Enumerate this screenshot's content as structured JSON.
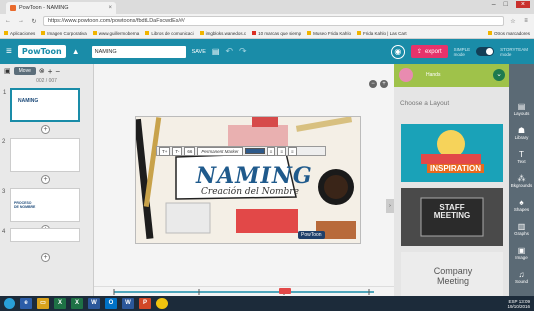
{
  "browser": {
    "tab_title": "PowToon - NAMING",
    "url": "https://www.powtoon.com/powtoons/fbdtLDaFscwdEs/#/",
    "bookmarks": [
      "Aplicaciones",
      "Imagen Corporativa",
      "www.guillermoberna",
      "Libros de comunicaci",
      "imgbloks.wanedos.c",
      "10 marcas que siemp",
      "Museo Frida Kahlo",
      "Frida Kahlo | Las Cart"
    ],
    "bookmarks_other": "Otros marcadores"
  },
  "app": {
    "logo": "PowToon",
    "title_input": "NAMING",
    "save_label": "SAVE",
    "export_label": "export",
    "mode_left": "SIMPLE\nmode",
    "mode_right": "STORYTEAM\nmode"
  },
  "slides": {
    "move_label": "Move",
    "counter": "002 / 007",
    "items": [
      {
        "num": "1",
        "title": "NAMING"
      },
      {
        "num": "2",
        "title": ""
      },
      {
        "num": "3",
        "title": "PROCESO DE NOMBRE"
      },
      {
        "num": "4",
        "title": ""
      }
    ]
  },
  "canvas": {
    "headline": "NAMING",
    "subtitle": "Creación del Nombre",
    "font_name": "Permanent Marker",
    "font_size": "66",
    "brand_tag": "PowToon"
  },
  "library": {
    "panel_title": "Hands",
    "choose_layout": "Choose a Layout",
    "layouts": [
      {
        "label": "INSPIRATION",
        "sub": "Bright"
      },
      {
        "label": "STAFF MEETING",
        "sub": ""
      },
      {
        "label": "Company Meeting",
        "sub": ""
      }
    ]
  },
  "sidebar": {
    "items": [
      "Layouts",
      "Library",
      "Text",
      "Bkgrounds",
      "Shapes",
      "Graphs",
      "Image",
      "Sound"
    ]
  },
  "taskbar": {
    "lang": "ESP",
    "time": "13:09",
    "date": "19/10/2016"
  },
  "colors": {
    "powtoon_blue": "#1a8ca8",
    "export_pink": "#e6336b",
    "sidebar_gray": "#5b6a75"
  }
}
